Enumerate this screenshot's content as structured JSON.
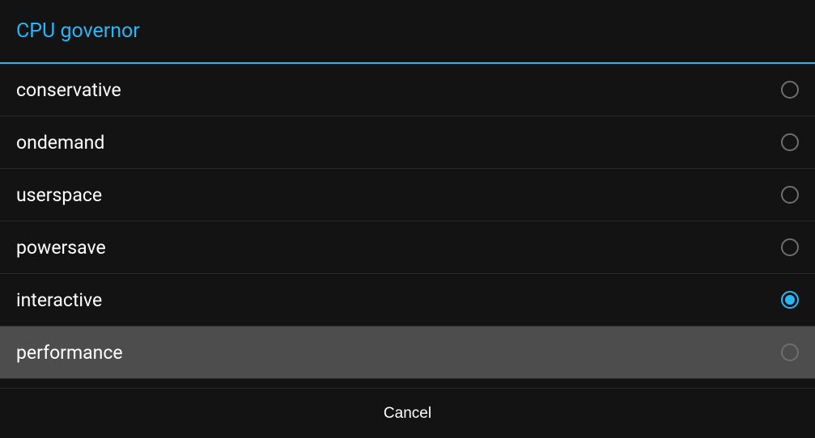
{
  "dialog": {
    "title": "CPU governor",
    "cancel_label": "Cancel"
  },
  "options": [
    {
      "label": "conservative",
      "selected": false,
      "highlighted": false
    },
    {
      "label": "ondemand",
      "selected": false,
      "highlighted": false
    },
    {
      "label": "userspace",
      "selected": false,
      "highlighted": false
    },
    {
      "label": "powersave",
      "selected": false,
      "highlighted": false
    },
    {
      "label": "interactive",
      "selected": true,
      "highlighted": false
    },
    {
      "label": "performance",
      "selected": false,
      "highlighted": true
    }
  ]
}
